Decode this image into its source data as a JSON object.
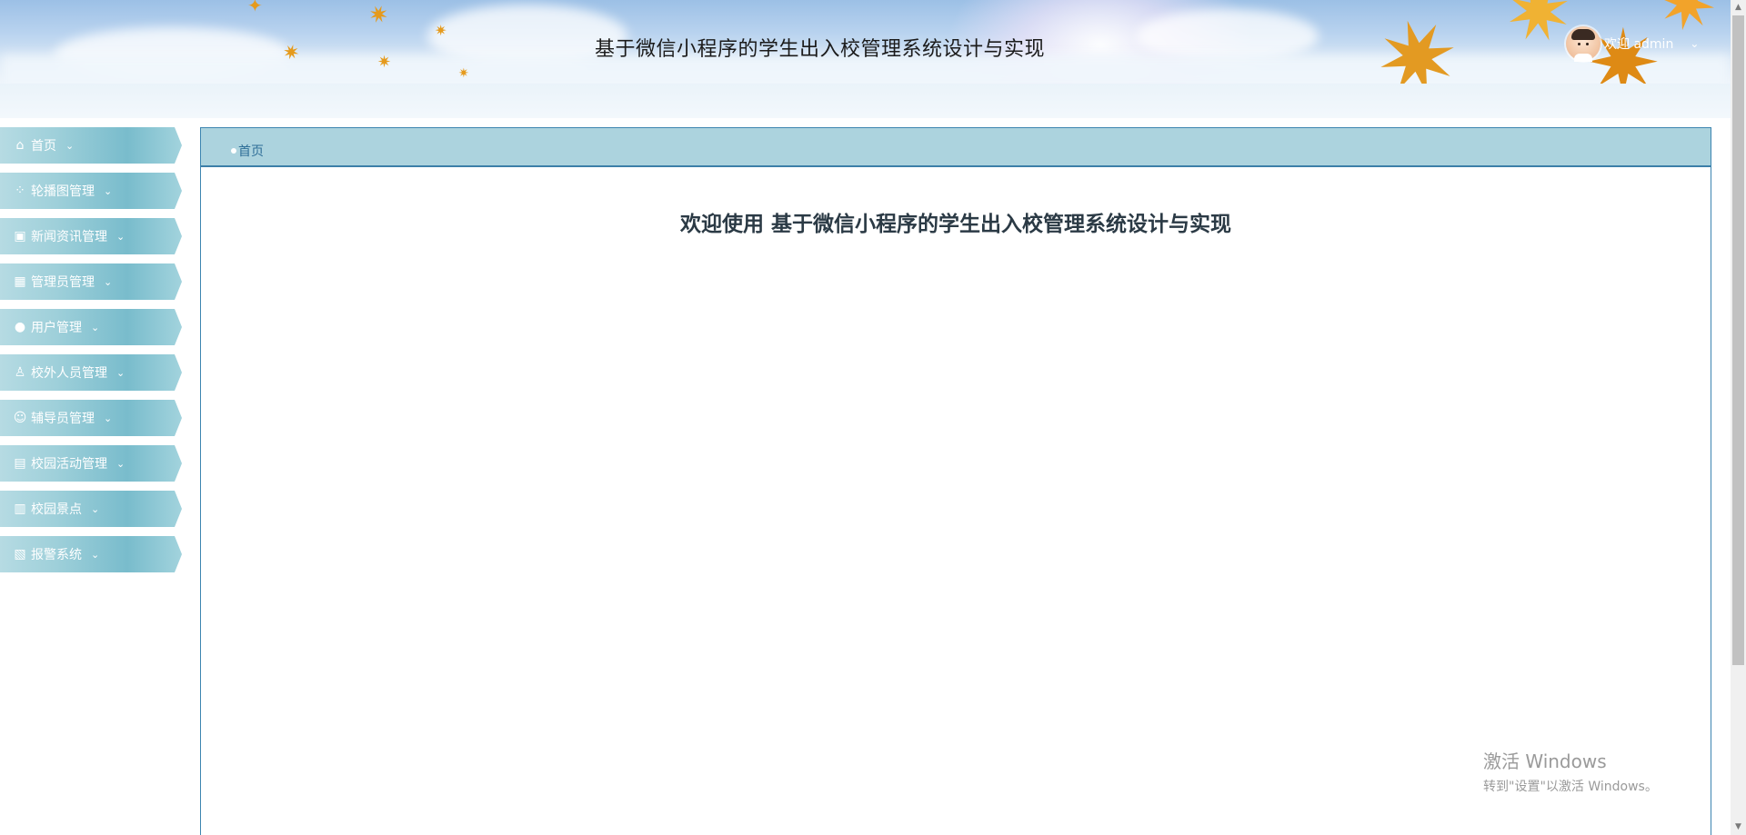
{
  "header": {
    "title": "基于微信小程序的学生出入校管理系统设计与实现",
    "user_label": "欢迎 admin",
    "user_chevron": "⌄"
  },
  "sidebar": {
    "items": [
      {
        "label": "首页",
        "icon": "home-icon",
        "glyph": "⌂"
      },
      {
        "label": "轮播图管理",
        "icon": "apps-icon",
        "glyph": "⁘"
      },
      {
        "label": "新闻资讯管理",
        "icon": "news-icon",
        "glyph": "▣"
      },
      {
        "label": "管理员管理",
        "icon": "chart-icon",
        "glyph": "▦"
      },
      {
        "label": "用户管理",
        "icon": "user-icon",
        "glyph": "●"
      },
      {
        "label": "校外人员管理",
        "icon": "badge-icon",
        "glyph": "♙"
      },
      {
        "label": "辅导员管理",
        "icon": "user-outline-icon",
        "glyph": "☺"
      },
      {
        "label": "校园活动管理",
        "icon": "archive-icon",
        "glyph": "▤"
      },
      {
        "label": "校园景点",
        "icon": "layout-icon",
        "glyph": "▥"
      },
      {
        "label": "报警系统",
        "icon": "panel-icon",
        "glyph": "▧"
      }
    ],
    "chevron": "⌄"
  },
  "main": {
    "breadcrumb": "首页",
    "welcome": "欢迎使用 基于微信小程序的学生出入校管理系统设计与实现"
  },
  "watermark": {
    "line1": "激活 Windows",
    "line2": "转到\"设置\"以激活 Windows。"
  },
  "colors": {
    "sidebar_accent": "#79bccc",
    "breadcrumb_bg": "#acd3de",
    "panel_border": "#3d85b0"
  }
}
